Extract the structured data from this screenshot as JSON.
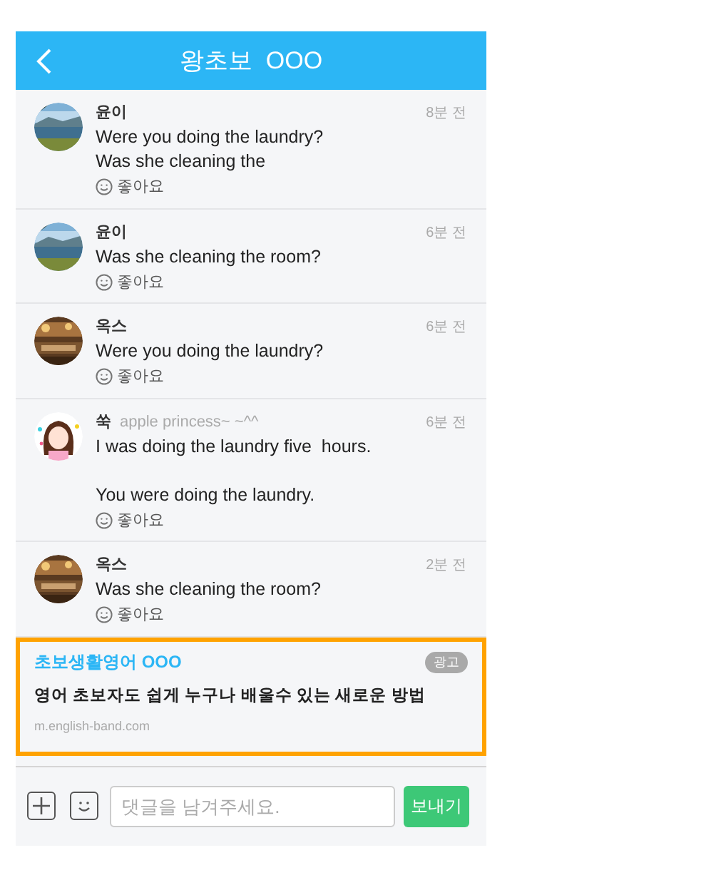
{
  "header": {
    "title": "왕초보  OOO"
  },
  "comments": [
    {
      "author": "윤이",
      "time": "8분 전",
      "text": "Were you doing the laundry?\nWas she cleaning the",
      "like": "좋아요"
    },
    {
      "author": "윤이",
      "time": "6분 전",
      "text": "Was she cleaning the room?",
      "like": "좋아요"
    },
    {
      "author": "옥스",
      "time": "6분 전",
      "text": "Were you doing the laundry?",
      "like": "좋아요"
    },
    {
      "author": "쑥",
      "subtitle": "apple princess~ ~^^",
      "time": "6분 전",
      "text": "I was doing the laundry five  hours.\n\nYou were doing the laundry.",
      "like": "좋아요"
    },
    {
      "author": "옥스",
      "time": "2분 전",
      "text": "Was she cleaning the room?",
      "like": "좋아요"
    }
  ],
  "ad": {
    "title": "초보생활영어 OOO",
    "badge": "광고",
    "headline": "영어 초보자도 쉽게 누구나 배울수 있는 새로운 방법",
    "url": "m.english-band.com"
  },
  "composer": {
    "placeholder": "댓글을 남겨주세요.",
    "send": "보내기"
  }
}
